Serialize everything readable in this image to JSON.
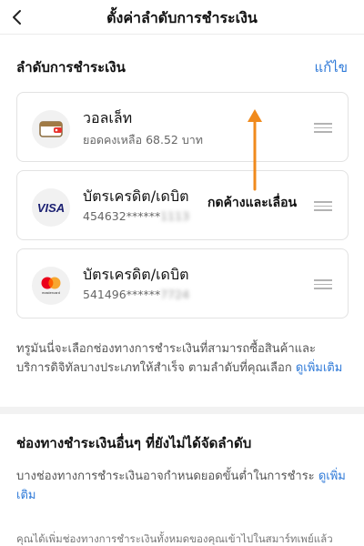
{
  "header": {
    "title": "ตั้งค่าลำดับการชำระเงิน",
    "back_icon": "chevron-left-icon"
  },
  "payment_order": {
    "title": "ลำดับการชำระเงิน",
    "edit_label": "แก้ไข",
    "items": [
      {
        "icon": "wallet-icon",
        "title": "วอลเล็ท",
        "subtitle": "ยอดคงเหลือ 68.52 บาท"
      },
      {
        "icon": "visa-logo",
        "logo_text": "VISA",
        "title": "บัตรเครดิต/เดบิต",
        "number_visible": "454632******",
        "number_masked": "1113"
      },
      {
        "icon": "mastercard-logo",
        "logo_text": "mastercard",
        "title": "บัตรเครดิต/เดบิต",
        "number_visible": "541496******",
        "number_masked": "7724"
      }
    ]
  },
  "annotation": {
    "text": "กดค้างและเลื่อน",
    "color": "#f08a1c"
  },
  "info_note": {
    "text": "ทรูมันนี่จะเลือกช่องทางการชำระเงินที่สามารถซื้อสินค้าและบริการดิจิทัลบางประเภทให้สำเร็จ ตามลำดับที่คุณเลือก ",
    "link": "ดูเพิ่มเติม"
  },
  "other_methods": {
    "title": "ช่องทางชำระเงินอื่นๆ ที่ยังไม่ได้จัดลำดับ",
    "note": "บางช่องทางการชำระเงินอาจกำหนดยอดขั้นต่ำในการชำระ ",
    "link": "ดูเพิ่มเติม"
  },
  "bottom_note": "คุณได้เพิ่มช่องทางการชำระเงินทั้งหมดของคุณเข้าไปในสมาร์ทเพย์แล้ว",
  "colors": {
    "accent": "#2f7ad8",
    "visa_blue": "#1a1f71",
    "mc_red": "#eb001b",
    "mc_orange": "#f79e1b",
    "wallet_red": "#e8322d"
  }
}
